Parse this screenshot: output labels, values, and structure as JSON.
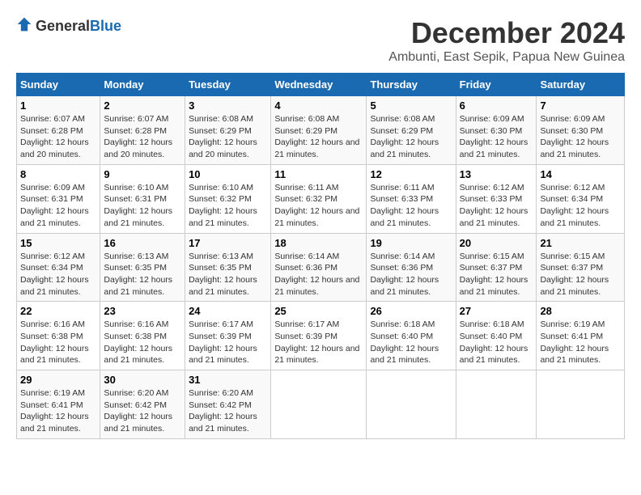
{
  "header": {
    "logo_general": "General",
    "logo_blue": "Blue",
    "main_title": "December 2024",
    "subtitle": "Ambunti, East Sepik, Papua New Guinea"
  },
  "days_of_week": [
    "Sunday",
    "Monday",
    "Tuesday",
    "Wednesday",
    "Thursday",
    "Friday",
    "Saturday"
  ],
  "weeks": [
    [
      {
        "day": "1",
        "sunrise": "Sunrise: 6:07 AM",
        "sunset": "Sunset: 6:28 PM",
        "daylight": "Daylight: 12 hours and 20 minutes."
      },
      {
        "day": "2",
        "sunrise": "Sunrise: 6:07 AM",
        "sunset": "Sunset: 6:28 PM",
        "daylight": "Daylight: 12 hours and 20 minutes."
      },
      {
        "day": "3",
        "sunrise": "Sunrise: 6:08 AM",
        "sunset": "Sunset: 6:29 PM",
        "daylight": "Daylight: 12 hours and 20 minutes."
      },
      {
        "day": "4",
        "sunrise": "Sunrise: 6:08 AM",
        "sunset": "Sunset: 6:29 PM",
        "daylight": "Daylight: 12 hours and 21 minutes."
      },
      {
        "day": "5",
        "sunrise": "Sunrise: 6:08 AM",
        "sunset": "Sunset: 6:29 PM",
        "daylight": "Daylight: 12 hours and 21 minutes."
      },
      {
        "day": "6",
        "sunrise": "Sunrise: 6:09 AM",
        "sunset": "Sunset: 6:30 PM",
        "daylight": "Daylight: 12 hours and 21 minutes."
      },
      {
        "day": "7",
        "sunrise": "Sunrise: 6:09 AM",
        "sunset": "Sunset: 6:30 PM",
        "daylight": "Daylight: 12 hours and 21 minutes."
      }
    ],
    [
      {
        "day": "8",
        "sunrise": "Sunrise: 6:09 AM",
        "sunset": "Sunset: 6:31 PM",
        "daylight": "Daylight: 12 hours and 21 minutes."
      },
      {
        "day": "9",
        "sunrise": "Sunrise: 6:10 AM",
        "sunset": "Sunset: 6:31 PM",
        "daylight": "Daylight: 12 hours and 21 minutes."
      },
      {
        "day": "10",
        "sunrise": "Sunrise: 6:10 AM",
        "sunset": "Sunset: 6:32 PM",
        "daylight": "Daylight: 12 hours and 21 minutes."
      },
      {
        "day": "11",
        "sunrise": "Sunrise: 6:11 AM",
        "sunset": "Sunset: 6:32 PM",
        "daylight": "Daylight: 12 hours and 21 minutes."
      },
      {
        "day": "12",
        "sunrise": "Sunrise: 6:11 AM",
        "sunset": "Sunset: 6:33 PM",
        "daylight": "Daylight: 12 hours and 21 minutes."
      },
      {
        "day": "13",
        "sunrise": "Sunrise: 6:12 AM",
        "sunset": "Sunset: 6:33 PM",
        "daylight": "Daylight: 12 hours and 21 minutes."
      },
      {
        "day": "14",
        "sunrise": "Sunrise: 6:12 AM",
        "sunset": "Sunset: 6:34 PM",
        "daylight": "Daylight: 12 hours and 21 minutes."
      }
    ],
    [
      {
        "day": "15",
        "sunrise": "Sunrise: 6:12 AM",
        "sunset": "Sunset: 6:34 PM",
        "daylight": "Daylight: 12 hours and 21 minutes."
      },
      {
        "day": "16",
        "sunrise": "Sunrise: 6:13 AM",
        "sunset": "Sunset: 6:35 PM",
        "daylight": "Daylight: 12 hours and 21 minutes."
      },
      {
        "day": "17",
        "sunrise": "Sunrise: 6:13 AM",
        "sunset": "Sunset: 6:35 PM",
        "daylight": "Daylight: 12 hours and 21 minutes."
      },
      {
        "day": "18",
        "sunrise": "Sunrise: 6:14 AM",
        "sunset": "Sunset: 6:36 PM",
        "daylight": "Daylight: 12 hours and 21 minutes."
      },
      {
        "day": "19",
        "sunrise": "Sunrise: 6:14 AM",
        "sunset": "Sunset: 6:36 PM",
        "daylight": "Daylight: 12 hours and 21 minutes."
      },
      {
        "day": "20",
        "sunrise": "Sunrise: 6:15 AM",
        "sunset": "Sunset: 6:37 PM",
        "daylight": "Daylight: 12 hours and 21 minutes."
      },
      {
        "day": "21",
        "sunrise": "Sunrise: 6:15 AM",
        "sunset": "Sunset: 6:37 PM",
        "daylight": "Daylight: 12 hours and 21 minutes."
      }
    ],
    [
      {
        "day": "22",
        "sunrise": "Sunrise: 6:16 AM",
        "sunset": "Sunset: 6:38 PM",
        "daylight": "Daylight: 12 hours and 21 minutes."
      },
      {
        "day": "23",
        "sunrise": "Sunrise: 6:16 AM",
        "sunset": "Sunset: 6:38 PM",
        "daylight": "Daylight: 12 hours and 21 minutes."
      },
      {
        "day": "24",
        "sunrise": "Sunrise: 6:17 AM",
        "sunset": "Sunset: 6:39 PM",
        "daylight": "Daylight: 12 hours and 21 minutes."
      },
      {
        "day": "25",
        "sunrise": "Sunrise: 6:17 AM",
        "sunset": "Sunset: 6:39 PM",
        "daylight": "Daylight: 12 hours and 21 minutes."
      },
      {
        "day": "26",
        "sunrise": "Sunrise: 6:18 AM",
        "sunset": "Sunset: 6:40 PM",
        "daylight": "Daylight: 12 hours and 21 minutes."
      },
      {
        "day": "27",
        "sunrise": "Sunrise: 6:18 AM",
        "sunset": "Sunset: 6:40 PM",
        "daylight": "Daylight: 12 hours and 21 minutes."
      },
      {
        "day": "28",
        "sunrise": "Sunrise: 6:19 AM",
        "sunset": "Sunset: 6:41 PM",
        "daylight": "Daylight: 12 hours and 21 minutes."
      }
    ],
    [
      {
        "day": "29",
        "sunrise": "Sunrise: 6:19 AM",
        "sunset": "Sunset: 6:41 PM",
        "daylight": "Daylight: 12 hours and 21 minutes."
      },
      {
        "day": "30",
        "sunrise": "Sunrise: 6:20 AM",
        "sunset": "Sunset: 6:42 PM",
        "daylight": "Daylight: 12 hours and 21 minutes."
      },
      {
        "day": "31",
        "sunrise": "Sunrise: 6:20 AM",
        "sunset": "Sunset: 6:42 PM",
        "daylight": "Daylight: 12 hours and 21 minutes."
      },
      null,
      null,
      null,
      null
    ]
  ]
}
